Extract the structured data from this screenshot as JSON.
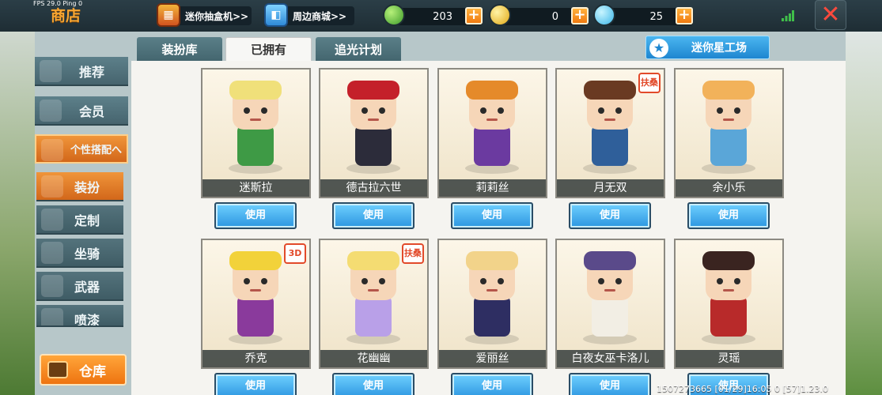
{
  "debug": {
    "fps": "FPS 29.0",
    "ping": "Ping 0"
  },
  "header": {
    "title": "商店",
    "gacha_label": "迷你抽盒机>>",
    "mall_label": "周边商城>>",
    "currencies": [
      {
        "icon": "green-gem-icon",
        "value": "203",
        "color": "#3d9c2a"
      },
      {
        "icon": "gold-coin-icon",
        "value": "0",
        "color": "#e1a814"
      },
      {
        "icon": "mini-coin-icon",
        "value": "25",
        "color": "#3bb6e8"
      }
    ],
    "close_symbol": "✕"
  },
  "sidebar": {
    "items": [
      {
        "label": "推荐",
        "icon": "thumbs-up-icon"
      },
      {
        "label": "会员",
        "icon": "vip-icon"
      },
      {
        "label": "个性搭配へ",
        "icon": "trophy-icon"
      },
      {
        "label": "装扮",
        "icon": "costume-icon"
      },
      {
        "label": "定制",
        "icon": "brush-icon"
      },
      {
        "label": "坐骑",
        "icon": "mount-icon"
      },
      {
        "label": "武器",
        "icon": "gun-icon"
      },
      {
        "label": "喷漆",
        "icon": "spray-icon"
      }
    ],
    "warehouse_label": "仓库"
  },
  "tabs": [
    {
      "label": "装扮库",
      "active": false
    },
    {
      "label": "已拥有",
      "active": true
    },
    {
      "label": "追光计划",
      "active": false
    }
  ],
  "star_workshop_label": "迷你星工场",
  "use_label": "使用",
  "skins": [
    {
      "name": "迷斯拉",
      "color": "#3e9a45",
      "accent": "#f0e07a"
    },
    {
      "name": "德古拉六世",
      "color": "#2c2c3a",
      "accent": "#c4202a"
    },
    {
      "name": "莉莉丝",
      "color": "#6b3aa0",
      "accent": "#e58a2a"
    },
    {
      "name": "月无双",
      "color": "#2f5f9a",
      "accent": "#6a3a22",
      "tag": "扶桑"
    },
    {
      "name": "余小乐",
      "color": "#5aa6d8",
      "accent": "#f2b25a"
    },
    {
      "name": "乔克",
      "color": "#8a3a9c",
      "accent": "#f2d23a",
      "tag": "3D"
    },
    {
      "name": "花幽幽",
      "color": "#b9a0e8",
      "accent": "#f4dc72",
      "tag": "扶桑"
    },
    {
      "name": "爱丽丝",
      "color": "#2e2e62",
      "accent": "#f2d38a"
    },
    {
      "name": "白夜女巫卡洛儿",
      "color": "#f2eee4",
      "accent": "#5a4a8a"
    },
    {
      "name": "灵瑶",
      "color": "#b82a2a",
      "accent": "#3a2420"
    }
  ],
  "footer": {
    "uid": "1507273665",
    "time": "[01/29]16:05 0",
    "version": "[57]1.23.0"
  }
}
